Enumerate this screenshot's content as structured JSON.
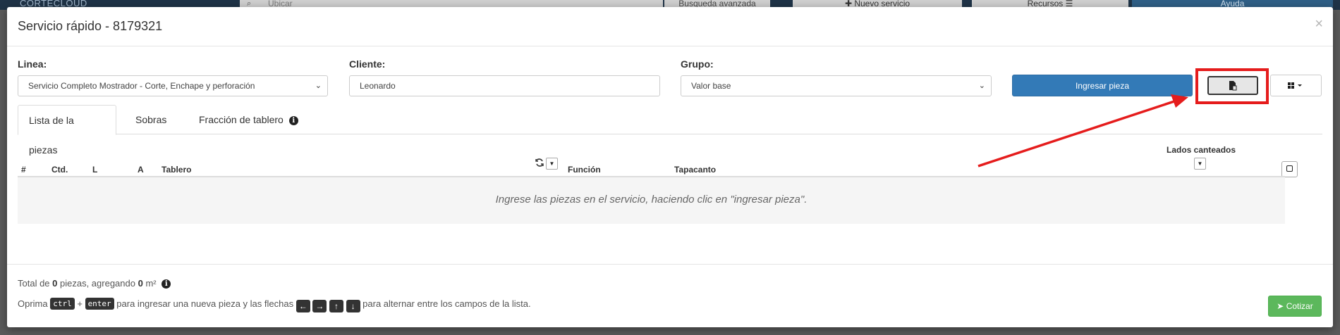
{
  "background": {
    "logo": "CORTECLOUD",
    "search_placeholder": "Ubicar",
    "advanced_search": "Busqueda avanzada",
    "new_service": "✚ Nuevo servicio",
    "resources": "Recursos ☰",
    "help": "Ayuda"
  },
  "modal": {
    "title": "Servicio rápido - 8179321",
    "close": "×"
  },
  "form": {
    "linea_label": "Linea:",
    "linea_value": "Servicio Completo Mostrador - Corte, Enchape y perforación",
    "cliente_label": "Cliente:",
    "cliente_value": "Leonardo",
    "grupo_label": "Grupo:",
    "grupo_value": "Valor base",
    "add_piece_button": "Ingresar pieza"
  },
  "tabs": [
    {
      "label": "Lista de la piezas"
    },
    {
      "label": "Sobras"
    },
    {
      "label": "Fracción de tablero"
    }
  ],
  "table": {
    "headers": {
      "num": "#",
      "qty": "Ctd.",
      "l": "L",
      "a": "A",
      "tablero": "Tablero",
      "funcion": "Función",
      "tapacanto": "Tapacanto",
      "lados": "Lados canteados"
    },
    "empty_message": "Ingrese las piezas en el servicio, haciendo clic en \"ingresar pieza\"."
  },
  "footer": {
    "total_prefix": "Total de ",
    "total_pieces": "0",
    "total_mid": " piezas, agregando ",
    "total_m2": "0",
    "total_unit": " m²",
    "hint_prefix": "Oprima ",
    "key_ctrl": "ctrl",
    "plus": " + ",
    "key_enter": "enter",
    "hint_mid": " para ingresar una nueva pieza y las flechas ",
    "hint_suffix": " para alternar entre los campos de la lista.",
    "quote_button": "Cotizar"
  },
  "colors": {
    "primary": "#337ab7",
    "success": "#5cb85c",
    "annotation": "#e51c1c"
  }
}
